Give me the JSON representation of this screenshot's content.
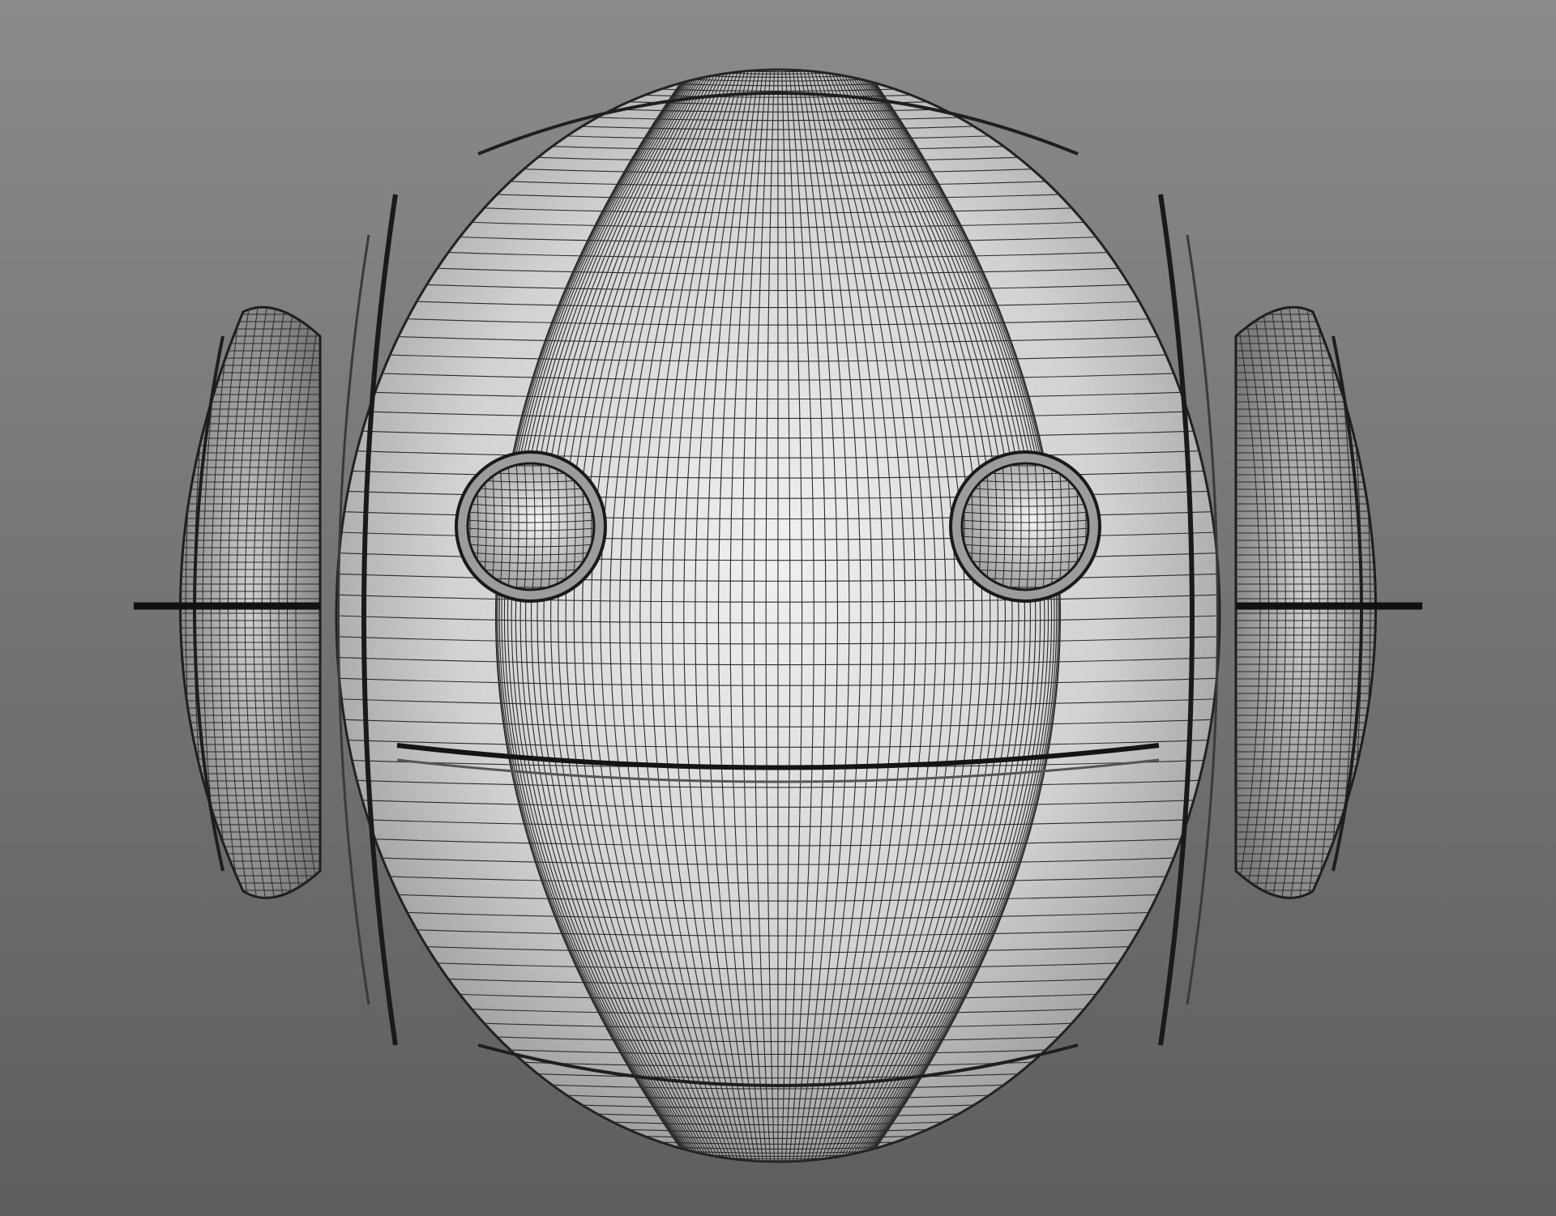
{
  "scene": {
    "subject": "robot-head-wireframe",
    "render_mode": "wireframe-shaded",
    "colors": {
      "background_top": "#8a8a8a",
      "background_bottom": "#5e5e5e",
      "surface_light": "#ececec",
      "surface_mid": "#bdbdbd",
      "surface_dark": "#7a7a7a",
      "wire": "#1e1e1e",
      "seam": "#141414"
    },
    "icons": {
      "head": "sphere-head",
      "eye_left": "eye-socket-left",
      "eye_right": "eye-socket-right",
      "ear_left": "ear-disc-left",
      "ear_right": "ear-disc-right"
    }
  }
}
